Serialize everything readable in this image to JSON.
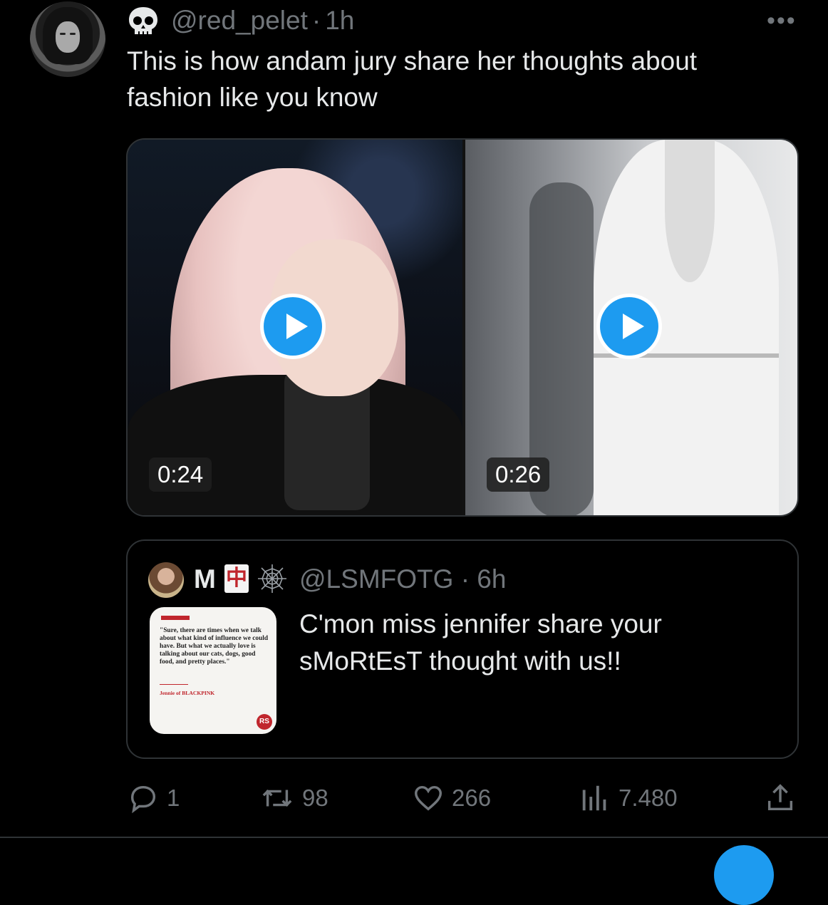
{
  "tweet": {
    "handle": "@red_pelet",
    "separator": "·",
    "time": "1h",
    "more": "•••",
    "text": "This is how andam jury share her thoughts about fashion like you know",
    "media": [
      {
        "duration": "0:24"
      },
      {
        "duration": "0:26"
      }
    ]
  },
  "quote": {
    "name": "M",
    "badge_char": "中",
    "handle": "@LSMFOTG",
    "separator": "·",
    "time": "6h",
    "text": "C'mon miss jennifer share  your sMoRtEsT thought with us!!",
    "thumbnail": {
      "quote": "\"Sure, there are times when we talk about what kind of influence we could have. But what we actually love is talking about our cats, dogs, good food, and pretty places.\"",
      "attribution": "Jennie of BLACKPINK",
      "logo": "RS"
    }
  },
  "actions": {
    "replies": "1",
    "reposts": "98",
    "likes": "266",
    "views": "7.480"
  },
  "colors": {
    "background": "#000000",
    "text": "#e7e9ea",
    "muted": "#71767b",
    "accent": "#1d9bf0",
    "border": "#2f3336"
  }
}
